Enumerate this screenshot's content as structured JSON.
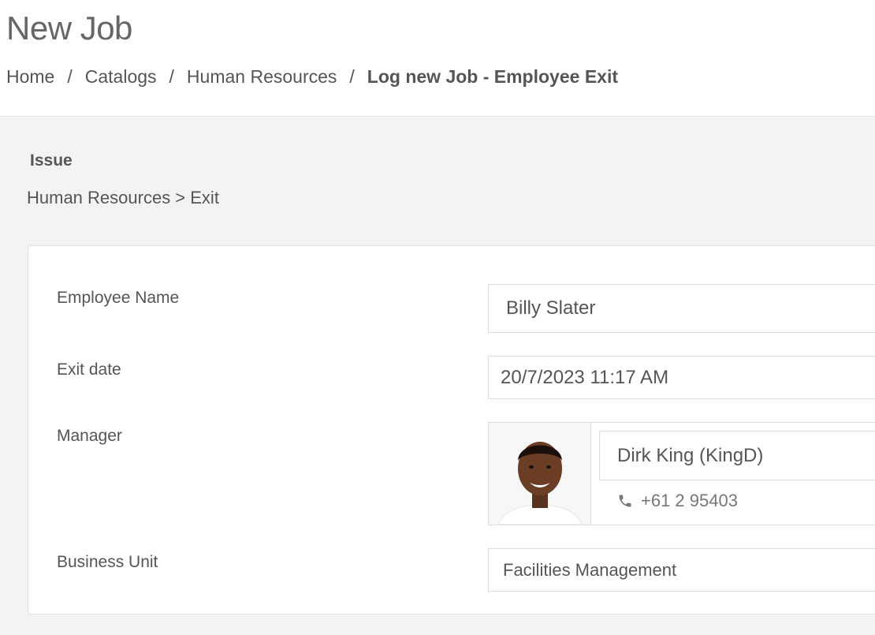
{
  "header": {
    "title": "New Job",
    "breadcrumb": {
      "home": "Home",
      "catalogs": "Catalogs",
      "human_resources": "Human Resources",
      "current": "Log new Job - Employee Exit",
      "separator": "/"
    }
  },
  "issue": {
    "heading": "Issue",
    "path": "Human Resources > Exit"
  },
  "form": {
    "employee_name": {
      "label": "Employee Name",
      "value": "Billy Slater"
    },
    "exit_date": {
      "label": "Exit date",
      "value": "20/7/2023 11:17 AM"
    },
    "manager": {
      "label": "Manager",
      "name": "Dirk King (KingD)",
      "phone": "+61 2 95403",
      "phone_icon": "phone-icon",
      "avatar_icon": "avatar"
    },
    "business_unit": {
      "label": "Business Unit",
      "value": "Facilities Management"
    }
  }
}
